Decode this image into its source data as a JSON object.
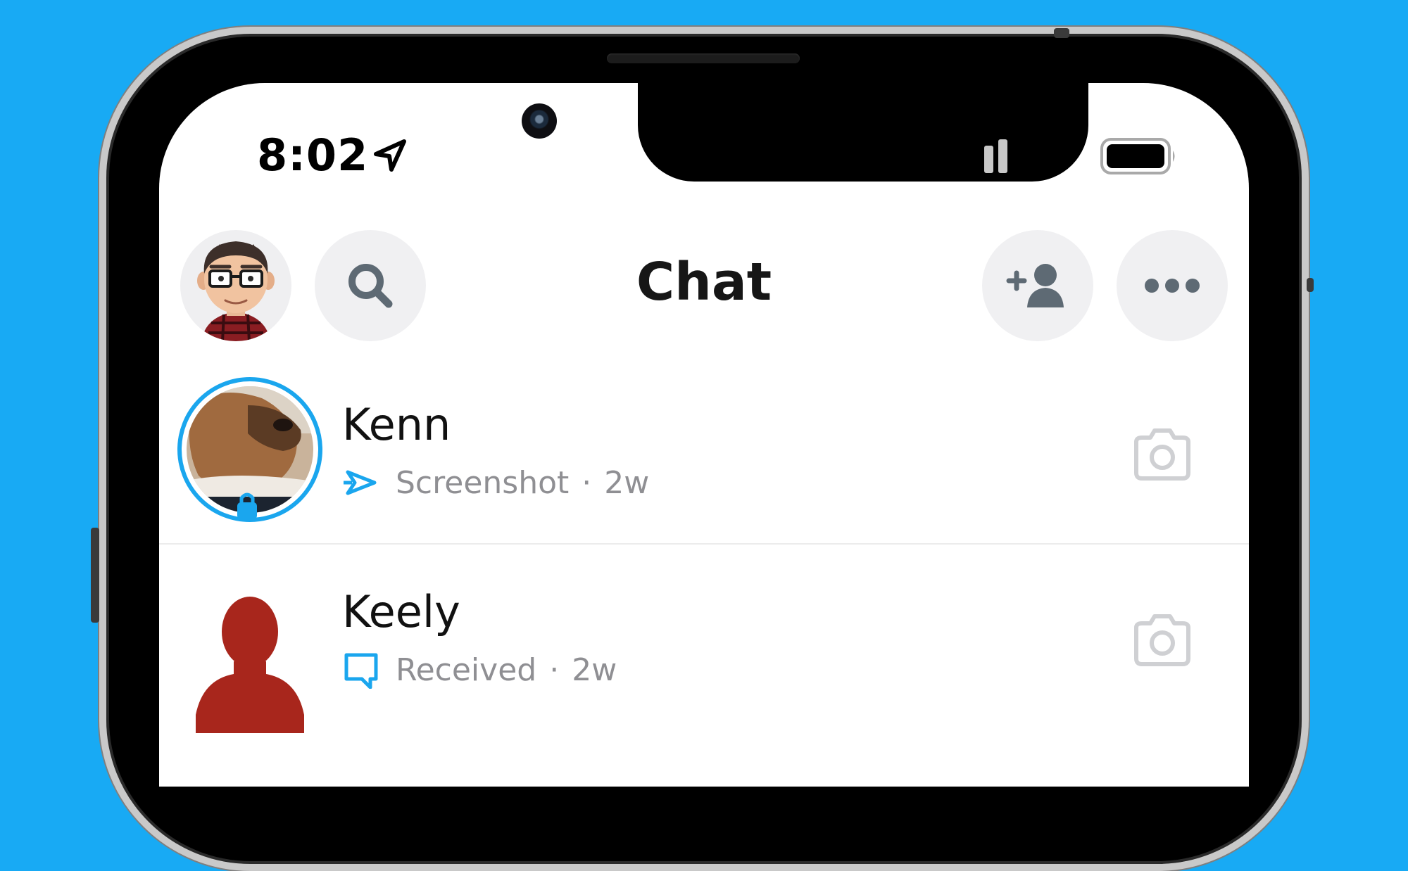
{
  "status_bar": {
    "time": "8:02"
  },
  "header": {
    "title": "Chat"
  },
  "chats": [
    {
      "name": "Kenn",
      "status": "Screenshot",
      "separator": "·",
      "age": "2w",
      "status_icon": "screenshot-arrows-icon",
      "status_color": "#1aa6ee"
    },
    {
      "name": "Keely",
      "status": "Received",
      "separator": "·",
      "age": "2w",
      "status_icon": "chat-bubble-icon",
      "status_color": "#1aa6ee"
    }
  ],
  "colors": {
    "background": "#18aaf4",
    "accent": "#1aa6ee",
    "bitmoji_red": "#a8261c"
  }
}
